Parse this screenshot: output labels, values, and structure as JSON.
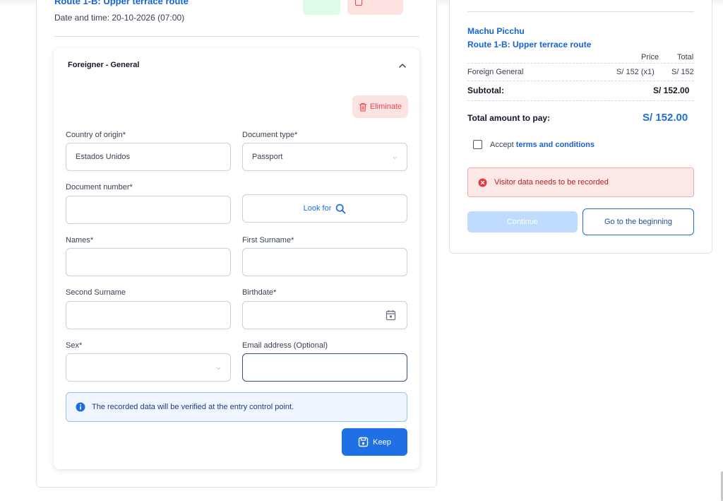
{
  "booking": {
    "route_title": "Route 1-B: Upper terrace route",
    "date_time": "Date and time: 20-10-2026 (07:00)"
  },
  "visitor_form": {
    "panel_title": "Foreigner - General",
    "eliminate_label": "Eliminate",
    "country": {
      "label": "Country of origin*",
      "value": "Estados Unidos"
    },
    "doc_type": {
      "label": "Document type*",
      "value": "Passport"
    },
    "doc_number": {
      "label": "Document number*",
      "value": ""
    },
    "look_for_label": "Look for",
    "names": {
      "label": "Names*",
      "value": ""
    },
    "first_surname": {
      "label": "First Surname*",
      "value": ""
    },
    "second_surname": {
      "label": "Second Surname",
      "value": ""
    },
    "birthdate": {
      "label": "Birthdate*",
      "value": ""
    },
    "sex": {
      "label": "Sex*",
      "value": ""
    },
    "email": {
      "label": "Email address (Optional)",
      "value": ""
    },
    "info_text": "The recorded data will be verified at the entry control point.",
    "keep_label": "Keep"
  },
  "summary": {
    "site": "Machu Picchu",
    "route": "Route 1-B: Upper terrace route",
    "col_price": "Price",
    "col_total": "Total",
    "items": [
      {
        "name": "Foreign General",
        "price": "S/ 152 (x1)",
        "total": "S/ 152"
      }
    ],
    "subtotal_label": "Subtotal:",
    "subtotal_value": "S/ 152.00",
    "total_label": "Total amount to pay:",
    "total_value": "S/ 152.00",
    "accept_prefix": "Accept",
    "terms_link": "terms and conditions",
    "alert_text": "Visitor data needs to be recorded",
    "continue_label": "Continue",
    "beginning_label": "Go to the beginning"
  },
  "colors": {
    "accent": "#1d6fe0",
    "error": "#b91c1c",
    "danger_bg": "#fde2e2"
  }
}
